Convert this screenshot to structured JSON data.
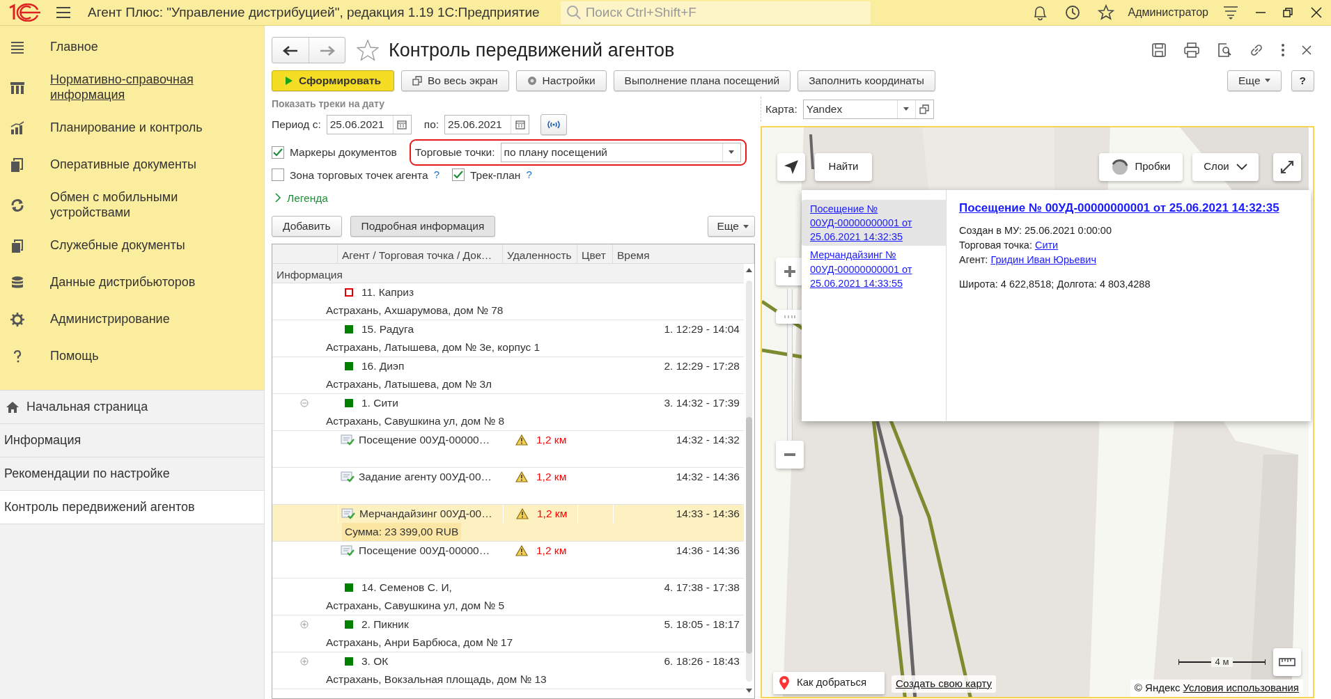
{
  "titlebar": {
    "title": "Агент Плюс: \"Управление дистрибуцией\", редакция 1.19 1С:Предприятие",
    "search_placeholder": "Поиск Ctrl+Shift+F",
    "user": "Администратор"
  },
  "sidebar": {
    "sections": [
      {
        "label": "Главное",
        "hovered": false
      },
      {
        "label": "Нормативно-справочная информация",
        "hovered": true
      },
      {
        "label": "Планирование и контроль",
        "hovered": false
      },
      {
        "label": "Оперативные документы",
        "hovered": false
      },
      {
        "label": "Обмен с мобильными устройствами",
        "hovered": false
      },
      {
        "label": "Служебные документы",
        "hovered": false
      },
      {
        "label": "Данные дистрибьюторов",
        "hovered": false
      },
      {
        "label": "Администрирование",
        "hovered": false
      },
      {
        "label": "Помощь",
        "hovered": false
      }
    ],
    "open_windows": [
      {
        "label": "Начальная страница",
        "selected": false
      },
      {
        "label": "Информация",
        "selected": false
      },
      {
        "label": "Рекомендации по настройке",
        "selected": false
      },
      {
        "label": "Контроль передвижений агентов",
        "selected": true
      }
    ]
  },
  "form": {
    "title": "Контроль передвижений агентов",
    "favorite": false,
    "toolbar": [
      {
        "label": "Сформировать",
        "kind": "run"
      },
      {
        "label": "Во весь экран",
        "kind": "fullscreen"
      },
      {
        "label": "Настройки",
        "kind": "settings"
      },
      {
        "label": "Выполнение плана посещений",
        "kind": "plain"
      },
      {
        "label": "Заполнить координаты",
        "kind": "plain"
      }
    ],
    "more": "Еще",
    "help": "?",
    "date_caption": "Показать треки на дату",
    "period_from_label": "Период с:",
    "period_from": "25.06.2021",
    "period_to_label": "по:",
    "period_to": "25.06.2021",
    "doc_markers": {
      "label": "Маркеры документов",
      "checked": true
    },
    "outlets": {
      "label": "Торговые точки:",
      "value": "по плану посещений",
      "highlighted": true
    },
    "zone": {
      "label": "Зона торговых точек агента",
      "checked": false,
      "help": "?"
    },
    "track_plan": {
      "label": "Трек-план",
      "checked": true,
      "help": "?"
    },
    "legend": {
      "label": "Легенда",
      "expanded": false
    },
    "list_buttons": [
      {
        "label": "Добавить",
        "pressed": false
      },
      {
        "label": "Подробная информация",
        "pressed": true
      }
    ],
    "list_more": "Еще",
    "table": {
      "columns": [
        "Агент / Торговая точка / Док…",
        "Удаленность",
        "Цвет",
        "Время"
      ],
      "group": "Информация",
      "rows": [
        {
          "kind": "point",
          "name": "11. Каприз",
          "address": "Астрахань, Ахшарумова, дом № 78",
          "color": "#e00000",
          "filled": false,
          "selected": false
        },
        {
          "kind": "point",
          "name": "15. Радуга",
          "address": "Астрахань, Латышева, дом № 3е, корпус 1",
          "time": "1. 12:29 - 14:04",
          "color": "#008000",
          "filled": true,
          "selected": false
        },
        {
          "kind": "point",
          "name": "16. Диэп",
          "address": "Астрахань, Латышева, дом № 3л",
          "time": "2. 12:29 - 17:28",
          "color": "#008000",
          "filled": true,
          "selected": false
        },
        {
          "kind": "point",
          "name": "1. Сити",
          "address": "Астрахань, Савушкина ул, дом № 8",
          "time": "3. 14:32 - 17:39",
          "color": "#008000",
          "filled": true,
          "expanded": true,
          "selected": false
        },
        {
          "kind": "document",
          "name": "Посещение 00УД-00000…",
          "warning": true,
          "distance": "1,2 км",
          "time": "14:32 - 14:32",
          "selected": false
        },
        {
          "kind": "document",
          "name": "Задание агенту 00УД-00…",
          "warning": true,
          "distance": "1,2 км",
          "time": "14:32 - 14:36",
          "selected": false
        },
        {
          "kind": "document",
          "name": "Мерчандайзинг 00УД-00…",
          "warning": true,
          "distance": "1,2 км",
          "time": "14:33 - 14:36",
          "sum": "Сумма: 23 399,00 RUB",
          "selected": true
        },
        {
          "kind": "document",
          "name": "Посещение 00УД-00000…",
          "warning": true,
          "distance": "1,2 км",
          "time": "14:36 - 14:36",
          "selected": false
        },
        {
          "kind": "point",
          "name": "14. Семенов С. И,",
          "address": "Астрахань, Савушкина ул, дом № 5",
          "time": "4. 17:38 - 17:38",
          "color": "#008000",
          "filled": true,
          "selected": false
        },
        {
          "kind": "point",
          "name": "2. Пикник",
          "address": "Астрахань, Анри Барбюса, дом № 17",
          "time": "5. 18:05 - 18:17",
          "color": "#008000",
          "filled": true,
          "expanded": false,
          "selected": false
        },
        {
          "kind": "point",
          "name": "3. ОК",
          "address": "Астрахань, Вокзальная площадь, дом № 13",
          "time": "6. 18:26 - 18:43",
          "color": "#008000",
          "filled": true,
          "expanded": false,
          "selected": false
        }
      ]
    }
  },
  "map": {
    "label": "Карта:",
    "provider": "Yandex",
    "find": "Найти",
    "traffic": "Пробки",
    "layers": "Слои",
    "zoom": {
      "level": 0.85
    },
    "popup": {
      "list": [
        {
          "text": "Посещение № 00УД-00000000001 от 25.06.2021 14:32:35",
          "selected": true
        },
        {
          "text": "Мерчандайзинг № 00УД-00000000001 от 25.06.2021 14:33:55",
          "selected": false
        }
      ],
      "heading": "Посещение № 00УД-00000000001 от 25.06.2021 14:32:35",
      "created": "Создан в МУ: 25.06.2021 0:00:00",
      "outlet_label": "Торговая точка:",
      "outlet": "Сити",
      "agent_label": "Агент:",
      "agent": "Гридин Иван Юрьевич",
      "coords": "Широта: 4 622,8518; Долгота: 4 803,4288"
    },
    "scale": "4 м",
    "route": "Как добраться",
    "create_map": "Создать свою карту",
    "copyright": "© Яндекс",
    "terms": "Условия использования"
  }
}
